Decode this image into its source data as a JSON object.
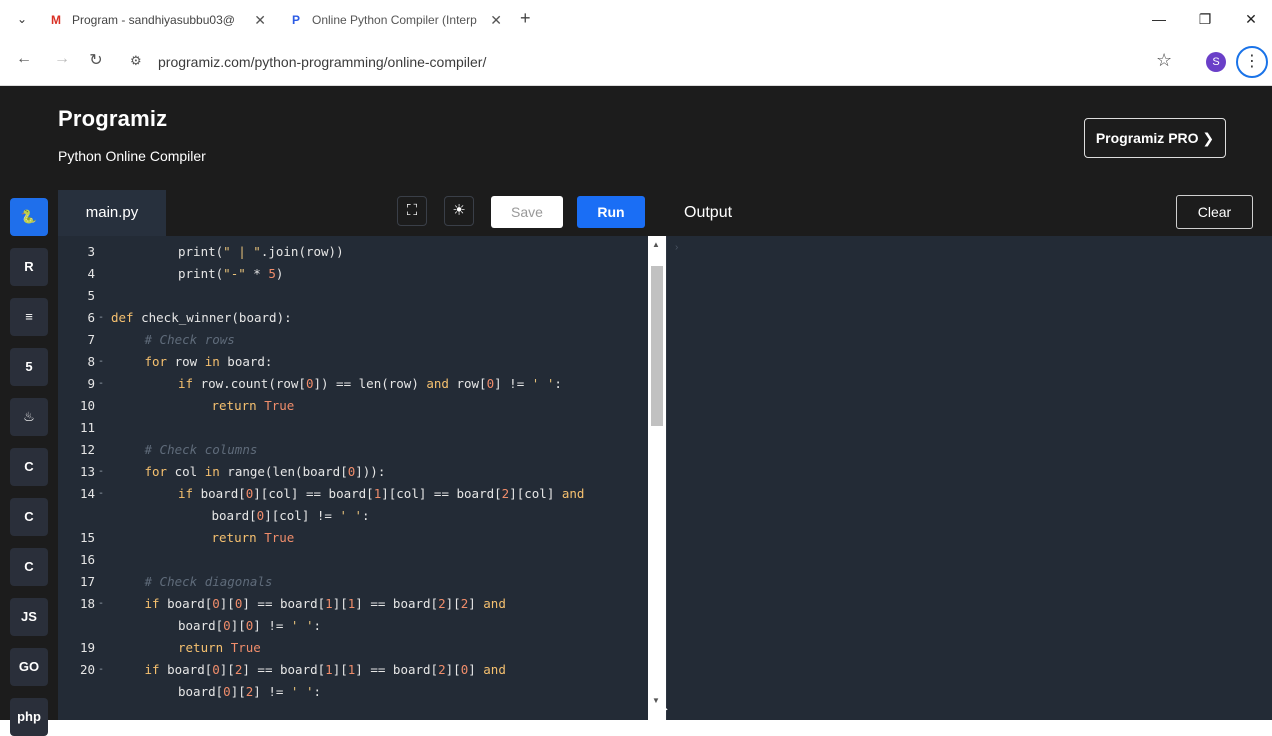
{
  "browser": {
    "tabs": [
      {
        "label": "Program - sandhiyasubbu03@",
        "favicon": "gmail-icon"
      },
      {
        "label": "Online Python Compiler (Interp",
        "favicon": "programiz-icon"
      }
    ],
    "url": "programiz.com/python-programming/online-compiler/",
    "profile_initial": "S"
  },
  "site": {
    "logo": "Programiz",
    "subtitle": "Python Online Compiler",
    "pro_button": "Programiz PRO ❯"
  },
  "editor": {
    "file_tab": "main.py",
    "save_label": "Save",
    "run_label": "Run",
    "lines": [
      {
        "n": "3",
        "fold": "",
        "indent": 2,
        "html": "<span class='fn'>print</span>(<span class='str'>\" | \"</span>.join(row))"
      },
      {
        "n": "4",
        "fold": "",
        "indent": 2,
        "html": "<span class='fn'>print</span>(<span class='str'>\"-\"</span> * <span class='num'>5</span>)"
      },
      {
        "n": "5",
        "fold": "",
        "indent": 0,
        "html": ""
      },
      {
        "n": "6",
        "fold": "-",
        "indent": 0,
        "html": "<span class='kw'>def</span> check_winner(board):"
      },
      {
        "n": "7",
        "fold": "",
        "indent": 1,
        "html": "<span class='cm'># Check rows</span>"
      },
      {
        "n": "8",
        "fold": "-",
        "indent": 1,
        "html": "<span class='kw'>for</span> row <span class='kw'>in</span> board:"
      },
      {
        "n": "9",
        "fold": "-",
        "indent": 2,
        "html": "<span class='kw'>if</span> row.count(row[<span class='num'>0</span>]) == len(row) <span class='kw'>and</span> row[<span class='num'>0</span>] != <span class='str'>' '</span>:"
      },
      {
        "n": "10",
        "fold": "",
        "indent": 3,
        "html": "<span class='kw'>return</span> <span class='tr'>True</span>"
      },
      {
        "n": "11",
        "fold": "",
        "indent": 0,
        "html": ""
      },
      {
        "n": "12",
        "fold": "",
        "indent": 1,
        "html": "<span class='cm'># Check columns</span>"
      },
      {
        "n": "13",
        "fold": "-",
        "indent": 1,
        "html": "<span class='kw'>for</span> col <span class='kw'>in</span> range(len(board[<span class='num'>0</span>])):"
      },
      {
        "n": "14",
        "fold": "-",
        "indent": 2,
        "html": "<span class='kw'>if</span> board[<span class='num'>0</span>][col] == board[<span class='num'>1</span>][col] == board[<span class='num'>2</span>][col] <span class='kw'>and</span>"
      },
      {
        "n": "",
        "fold": "",
        "indent": 3,
        "html": "board[<span class='num'>0</span>][col] != <span class='str'>' '</span>:"
      },
      {
        "n": "15",
        "fold": "",
        "indent": 3,
        "html": "<span class='kw'>return</span> <span class='tr'>True</span>"
      },
      {
        "n": "16",
        "fold": "",
        "indent": 0,
        "html": ""
      },
      {
        "n": "17",
        "fold": "",
        "indent": 1,
        "html": "<span class='cm'># Check diagonals</span>"
      },
      {
        "n": "18",
        "fold": "-",
        "indent": 1,
        "html": "<span class='kw'>if</span> board[<span class='num'>0</span>][<span class='num'>0</span>] == board[<span class='num'>1</span>][<span class='num'>1</span>] == board[<span class='num'>2</span>][<span class='num'>2</span>] <span class='kw'>and</span>"
      },
      {
        "n": "",
        "fold": "",
        "indent": 2,
        "html": "board[<span class='num'>0</span>][<span class='num'>0</span>] != <span class='str'>' '</span>:"
      },
      {
        "n": "19",
        "fold": "",
        "indent": 2,
        "html": "<span class='kw'>return</span> <span class='tr'>True</span>"
      },
      {
        "n": "20",
        "fold": "-",
        "indent": 1,
        "html": "<span class='kw'>if</span> board[<span class='num'>0</span>][<span class='num'>2</span>] == board[<span class='num'>1</span>][<span class='num'>1</span>] == board[<span class='num'>2</span>][<span class='num'>0</span>] <span class='kw'>and</span>"
      },
      {
        "n": "",
        "fold": "",
        "indent": 2,
        "html": "board[<span class='num'>0</span>][<span class='num'>2</span>] != <span class='str'>' '</span>:"
      }
    ]
  },
  "output": {
    "label": "Output",
    "clear_label": "Clear"
  },
  "rail": [
    {
      "name": "python-icon",
      "glyph": "🐍",
      "active": true
    },
    {
      "name": "r-icon",
      "glyph": "R"
    },
    {
      "name": "sql-icon",
      "glyph": "≡"
    },
    {
      "name": "html-icon",
      "glyph": "5"
    },
    {
      "name": "java-icon",
      "glyph": "♨"
    },
    {
      "name": "c-icon",
      "glyph": "C"
    },
    {
      "name": "cpp-icon",
      "glyph": "C"
    },
    {
      "name": "csharp-icon",
      "glyph": "C"
    },
    {
      "name": "js-icon",
      "glyph": "JS"
    },
    {
      "name": "go-icon",
      "glyph": "GO"
    },
    {
      "name": "php-icon",
      "glyph": "php"
    }
  ]
}
